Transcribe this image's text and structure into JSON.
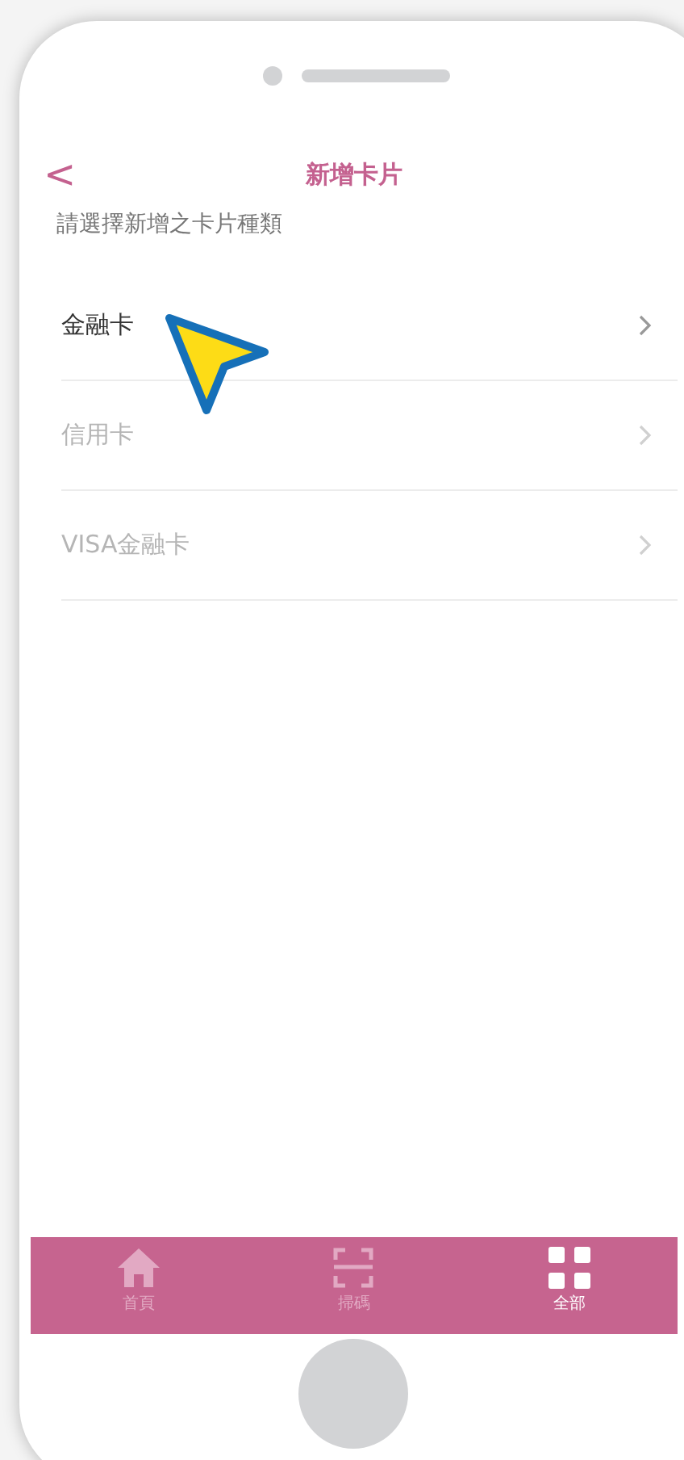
{
  "header": {
    "back": "<",
    "title": "新增卡片"
  },
  "prompt": "請選擇新增之卡片種類",
  "card_types": [
    {
      "label": "金融卡",
      "disabled": false
    },
    {
      "label": "信用卡",
      "disabled": true
    },
    {
      "label": "VISA金融卡",
      "disabled": true
    }
  ],
  "tab_bar": [
    {
      "kind": "home",
      "label": "首頁",
      "selected": false
    },
    {
      "kind": "scan",
      "label": "掃碼",
      "selected": false
    },
    {
      "kind": "all",
      "label": "全部",
      "selected": true
    }
  ]
}
